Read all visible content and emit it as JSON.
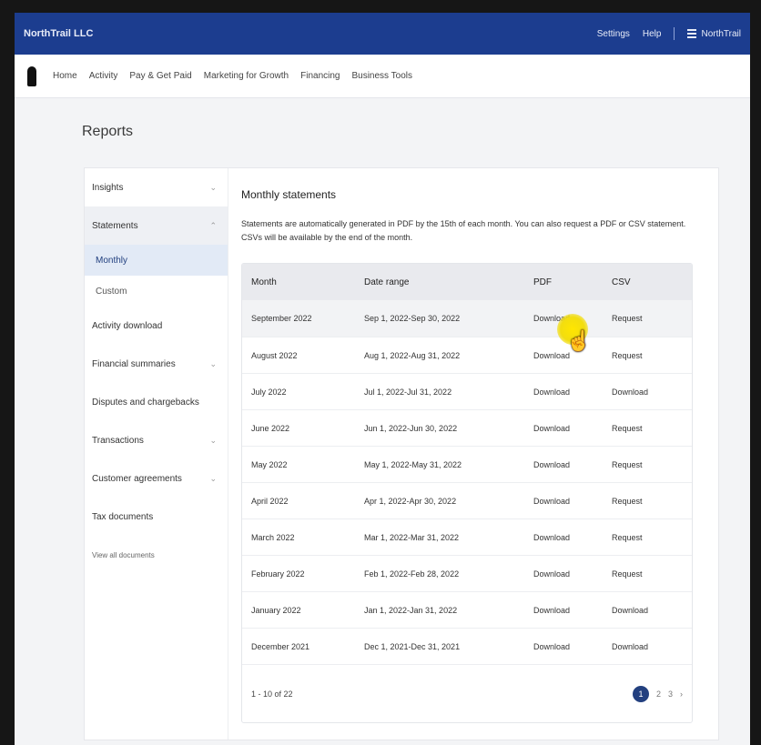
{
  "app": {
    "brand": "NorthTrail LLC"
  },
  "topbar": {
    "links": [
      "Settings",
      "Help"
    ],
    "account_label": "NorthTrail"
  },
  "nav": {
    "items": [
      "Home",
      "Activity",
      "Pay & Get Paid",
      "Marketing for Growth",
      "Financing",
      "Business Tools"
    ]
  },
  "page": {
    "title": "Reports"
  },
  "sidebar": {
    "items": [
      {
        "label": "Insights",
        "chevron": true
      },
      {
        "label": "Statements",
        "chevron": true,
        "open": true
      },
      {
        "label": "Monthly",
        "sub": true,
        "active": true
      },
      {
        "label": "Custom",
        "sub": true
      },
      {
        "label": "Activity download",
        "chevron": false
      },
      {
        "label": "Financial summaries",
        "chevron": true
      },
      {
        "label": "Disputes and chargebacks",
        "chevron": false
      },
      {
        "label": "Transactions",
        "chevron": true
      },
      {
        "label": "Customer agreements",
        "chevron": true
      },
      {
        "label": "Tax documents",
        "chevron": false
      },
      {
        "label": "View all documents",
        "chevron": false,
        "small": true
      }
    ]
  },
  "main": {
    "heading": "Monthly statements",
    "description": "Statements are automatically generated in PDF by the 15th of each month. You can also request a PDF or CSV statement. CSVs will be available by the end of the month."
  },
  "table": {
    "columns": [
      "Month",
      "Date range",
      "PDF",
      "CSV"
    ],
    "rows": [
      [
        "September 2022",
        "Sep 1, 2022-Sep 30, 2022",
        "Download",
        "Request"
      ],
      [
        "August 2022",
        "Aug 1, 2022-Aug 31, 2022",
        "Download",
        "Request"
      ],
      [
        "July 2022",
        "Jul 1, 2022-Jul 31, 2022",
        "Download",
        "Download"
      ],
      [
        "June 2022",
        "Jun 1, 2022-Jun 30, 2022",
        "Download",
        "Request"
      ],
      [
        "May 2022",
        "May 1, 2022-May 31, 2022",
        "Download",
        "Request"
      ],
      [
        "April 2022",
        "Apr 1, 2022-Apr 30, 2022",
        "Download",
        "Request"
      ],
      [
        "March 2022",
        "Mar 1, 2022-Mar 31, 2022",
        "Download",
        "Request"
      ],
      [
        "February 2022",
        "Feb 1, 2022-Feb 28, 2022",
        "Download",
        "Request"
      ],
      [
        "January 2022",
        "Jan 1, 2022-Jan 31, 2022",
        "Download",
        "Download"
      ],
      [
        "December 2021",
        "Dec 1, 2021-Dec 31, 2021",
        "Download",
        "Download"
      ]
    ],
    "footer_count": "1 - 10 of 22",
    "pager": {
      "current": "1",
      "pages": [
        "2",
        "3"
      ],
      "next": "›"
    }
  },
  "colors": {
    "topbar": "#1c3d8f",
    "accent": "#23407f",
    "cursor_highlight": "#ffe600"
  }
}
